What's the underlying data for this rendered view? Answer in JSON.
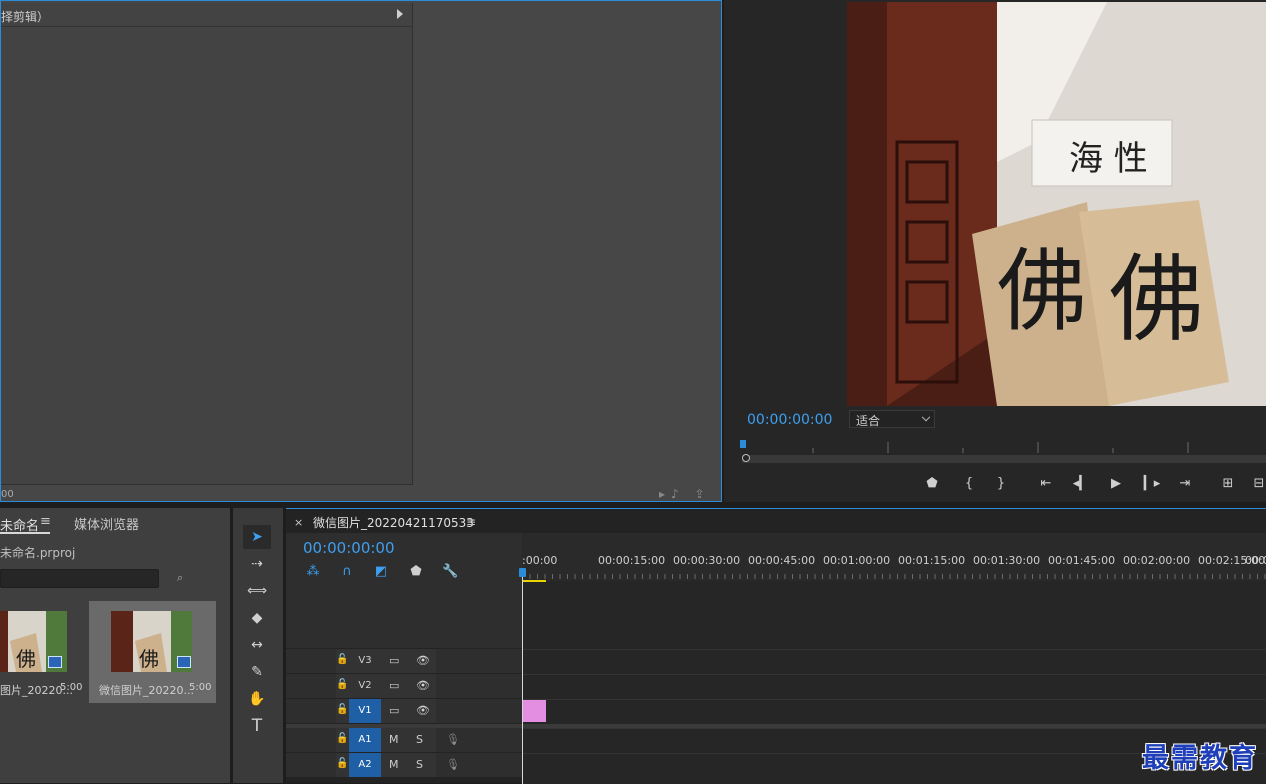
{
  "source_panel": {
    "effect_header": "择剪辑）",
    "timecode": "00"
  },
  "program": {
    "timecode": "00:00:00:00",
    "fit": "适合",
    "image_text_sign": "海 性",
    "image_text_card": "佛"
  },
  "project": {
    "tab_label": "未命名",
    "menu_glyph": "≡",
    "media_tab": "媒体浏览器",
    "filename": "未命名.prproj",
    "clips": [
      {
        "name": "图片_20220...",
        "duration": "5:00"
      },
      {
        "name": "微信图片_20220...",
        "duration": "5:00"
      }
    ]
  },
  "timeline": {
    "close_glyph": "×",
    "sequence_name": "微信图片_20220421170533",
    "menu_glyph": "≡",
    "timecode": "00:00:00:00",
    "ruler_labels": [
      ":00:00",
      "00:00:15:00",
      "00:00:30:00",
      "00:00:45:00",
      "00:01:00:00",
      "00:01:15:00",
      "00:01:30:00",
      "00:01:45:00",
      "00:02:00:00",
      "00:02:15:00",
      "00:0"
    ],
    "tracks": [
      {
        "label": "V3",
        "ctl1": "▭",
        "ctl2": "👁"
      },
      {
        "label": "V2",
        "ctl1": "▭",
        "ctl2": "👁"
      },
      {
        "label": "V1",
        "ctl1": "▭",
        "ctl2": "👁"
      },
      {
        "label": "A1",
        "ctl1": "M",
        "ctl2": "S"
      },
      {
        "label": "A2",
        "ctl1": "M",
        "ctl2": "S"
      }
    ]
  },
  "watermark": "最需教育",
  "colors": {
    "accent": "#2b8cd9",
    "timecode": "#3e9ff0",
    "clip": "#e38ee0",
    "track_active": "#1f5fa6"
  }
}
